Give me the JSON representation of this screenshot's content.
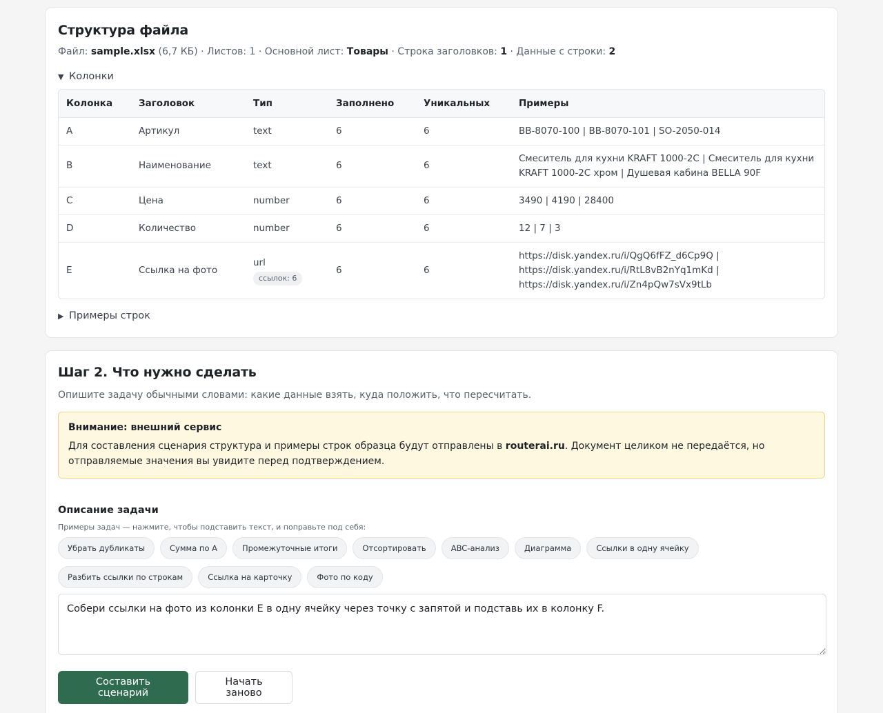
{
  "structure": {
    "title": "Структура файла",
    "meta": {
      "file_label": "Файл: ",
      "file_name": "sample.xlsx",
      "file_size": " (6,7 КБ)",
      "sheets_text": " · Листов: 1 · Основной лист: ",
      "main_sheet": "Товары",
      "header_row_text": " · Строка заголовков: ",
      "header_row": "1",
      "data_start_text": " · Данные с строки: ",
      "data_start": "2"
    },
    "columns_toggle": "Колонки",
    "columns_toggle_icon": "▼",
    "table": {
      "headers": [
        "Колонка",
        "Заголовок",
        "Тип",
        "Заполнено",
        "Уникальных",
        "Примеры"
      ],
      "rows": [
        {
          "col": "A",
          "header": "Артикул",
          "type": "text",
          "badge": "",
          "filled": "6",
          "unique": "6",
          "examples": "BB-8070-100 | BB-8070-101 | SO-2050-014"
        },
        {
          "col": "B",
          "header": "Наименование",
          "type": "text",
          "badge": "",
          "filled": "6",
          "unique": "6",
          "examples": "Смеситель для кухни KRAFT 1000-2C | Смеситель для кухни KRAFT 1000-2C хром | Душевая кабина BELLA 90F"
        },
        {
          "col": "C",
          "header": "Цена",
          "type": "number",
          "badge": "",
          "filled": "6",
          "unique": "6",
          "examples": "3490 | 4190 | 28400"
        },
        {
          "col": "D",
          "header": "Количество",
          "type": "number",
          "badge": "",
          "filled": "6",
          "unique": "6",
          "examples": "12 | 7 | 3"
        },
        {
          "col": "E",
          "header": "Ссылка на фото",
          "type": "url",
          "badge": "ссылок: 6",
          "filled": "6",
          "unique": "6",
          "examples": "https://disk.yandex.ru/i/QgQ6fFZ_d6Cp9Q | https://disk.yandex.ru/i/RtL8vB2nYq1mKd | https://disk.yandex.ru/i/Zn4pQw7sVx9tLb"
        }
      ]
    },
    "rows_toggle": "Примеры строк",
    "rows_toggle_icon": "▶"
  },
  "step2": {
    "title": "Шаг 2. Что нужно сделать",
    "subtitle": "Опишите задачу обычными словами: какие данные взять, куда положить, что пересчитать.",
    "warning": {
      "title": "Внимание: внешний сервис",
      "body_before": "Для составления сценария структура и примеры строк образца будут отправлены в ",
      "service": "routerai.ru",
      "body_after": ". Документ целиком не передаётся, но отправляемые значения вы увидите перед подтверждением."
    },
    "field_label": "Описание задачи",
    "hint": "Примеры задач — нажмите, чтобы подставить текст, и поправьте под себя:",
    "chips": [
      "Убрать дубликаты",
      "Сумма по A",
      "Промежуточные итоги",
      "Отсортировать",
      "ABC-анализ",
      "Диаграмма",
      "Ссылки в одну ячейку",
      "Разбить ссылки по строкам",
      "Ссылка на карточку",
      "Фото по коду"
    ],
    "task_value": "Собери ссылки на фото из колонки E в одну ячейку через точку с запятой и подставь их в колонку F.",
    "primary_button": "Составить сценарий",
    "secondary_button": "Начать заново"
  },
  "colors": {
    "primary": "#2f6b4f",
    "warning_bg": "#fff8e1",
    "warning_border": "#ecd58a"
  }
}
